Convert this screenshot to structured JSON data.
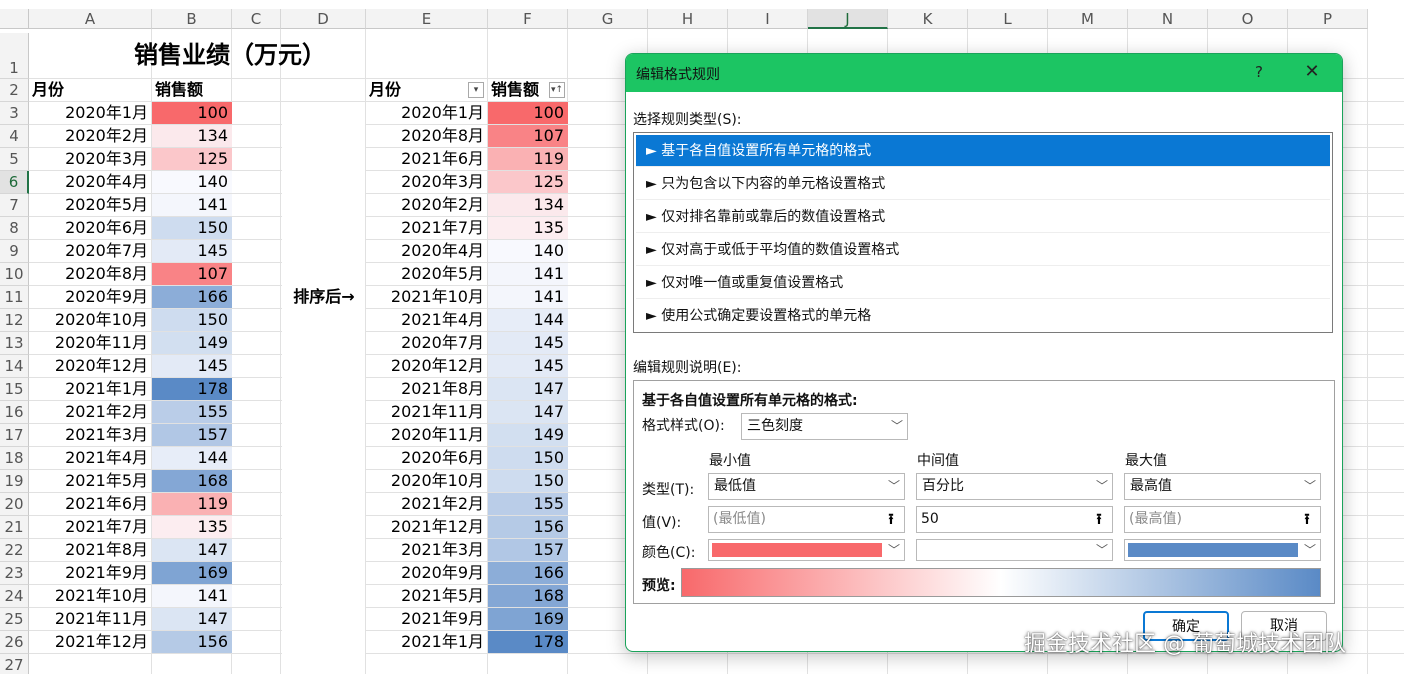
{
  "sheet": {
    "columns": [
      "A",
      "B",
      "C",
      "D",
      "E",
      "F",
      "G",
      "H",
      "I",
      "J",
      "K",
      "L",
      "M",
      "N",
      "O",
      "P"
    ],
    "selected_column": "J",
    "selected_row": 6,
    "title": "销售业绩（万元）",
    "col_a_header": "月份",
    "col_b_header": "销售额",
    "col_e_header": "月份",
    "col_f_header": "销售额",
    "sort_note": "排序后→",
    "original": [
      [
        "2020年1月",
        100
      ],
      [
        "2020年2月",
        134
      ],
      [
        "2020年3月",
        125
      ],
      [
        "2020年4月",
        140
      ],
      [
        "2020年5月",
        141
      ],
      [
        "2020年6月",
        150
      ],
      [
        "2020年7月",
        145
      ],
      [
        "2020年8月",
        107
      ],
      [
        "2020年9月",
        166
      ],
      [
        "2020年10月",
        150
      ],
      [
        "2020年11月",
        149
      ],
      [
        "2020年12月",
        145
      ],
      [
        "2021年1月",
        178
      ],
      [
        "2021年2月",
        155
      ],
      [
        "2021年3月",
        157
      ],
      [
        "2021年4月",
        144
      ],
      [
        "2021年5月",
        168
      ],
      [
        "2021年6月",
        119
      ],
      [
        "2021年7月",
        135
      ],
      [
        "2021年8月",
        147
      ],
      [
        "2021年9月",
        169
      ],
      [
        "2021年10月",
        141
      ],
      [
        "2021年11月",
        147
      ],
      [
        "2021年12月",
        156
      ]
    ],
    "sorted": [
      [
        "2020年1月",
        100
      ],
      [
        "2020年8月",
        107
      ],
      [
        "2021年6月",
        119
      ],
      [
        "2020年3月",
        125
      ],
      [
        "2020年2月",
        134
      ],
      [
        "2021年7月",
        135
      ],
      [
        "2020年4月",
        140
      ],
      [
        "2020年5月",
        141
      ],
      [
        "2021年10月",
        141
      ],
      [
        "2021年4月",
        144
      ],
      [
        "2020年7月",
        145
      ],
      [
        "2020年12月",
        145
      ],
      [
        "2021年8月",
        147
      ],
      [
        "2021年11月",
        147
      ],
      [
        "2020年11月",
        149
      ],
      [
        "2020年6月",
        150
      ],
      [
        "2020年10月",
        150
      ],
      [
        "2021年2月",
        155
      ],
      [
        "2021年12月",
        156
      ],
      [
        "2021年3月",
        157
      ],
      [
        "2020年9月",
        166
      ],
      [
        "2021年5月",
        168
      ],
      [
        "2021年9月",
        169
      ],
      [
        "2021年1月",
        178
      ]
    ],
    "scale_colors": {
      "min": "#f8696b",
      "mid": "#fcfcff",
      "max": "#5a8ac6"
    }
  },
  "dialog": {
    "title": "编辑格式规则",
    "help": "?",
    "close": "✕",
    "rule_type_label": "选择规则类型(S):",
    "rule_types": [
      "► 基于各自值设置所有单元格的格式",
      "► 只为包含以下内容的单元格设置格式",
      "► 仅对排名靠前或靠后的数值设置格式",
      "► 仅对高于或低于平均值的数值设置格式",
      "► 仅对唯一值或重复值设置格式",
      "► 使用公式确定要设置格式的单元格"
    ],
    "desc_label": "编辑规则说明(E):",
    "desc_heading": "基于各自值设置所有单元格的格式:",
    "format_style_label": "格式样式(O):",
    "format_style_value": "三色刻度",
    "min_header": "最小值",
    "mid_header": "中间值",
    "max_header": "最大值",
    "type_label": "类型(T):",
    "value_label": "值(V):",
    "color_label": "颜色(C):",
    "min_type": "最低值",
    "mid_type": "百分比",
    "max_type": "最高值",
    "min_value_placeholder": "(最低值)",
    "mid_value": "50",
    "max_value_placeholder": "(最高值)",
    "min_color": "#f8696b",
    "mid_color": "#ffffff",
    "max_color": "#5a8ac6",
    "preview_label": "预览:",
    "ok_label": "确定",
    "cancel_label": "取消"
  },
  "watermark": "掘金技术社区 @ 葡萄城技术团队"
}
